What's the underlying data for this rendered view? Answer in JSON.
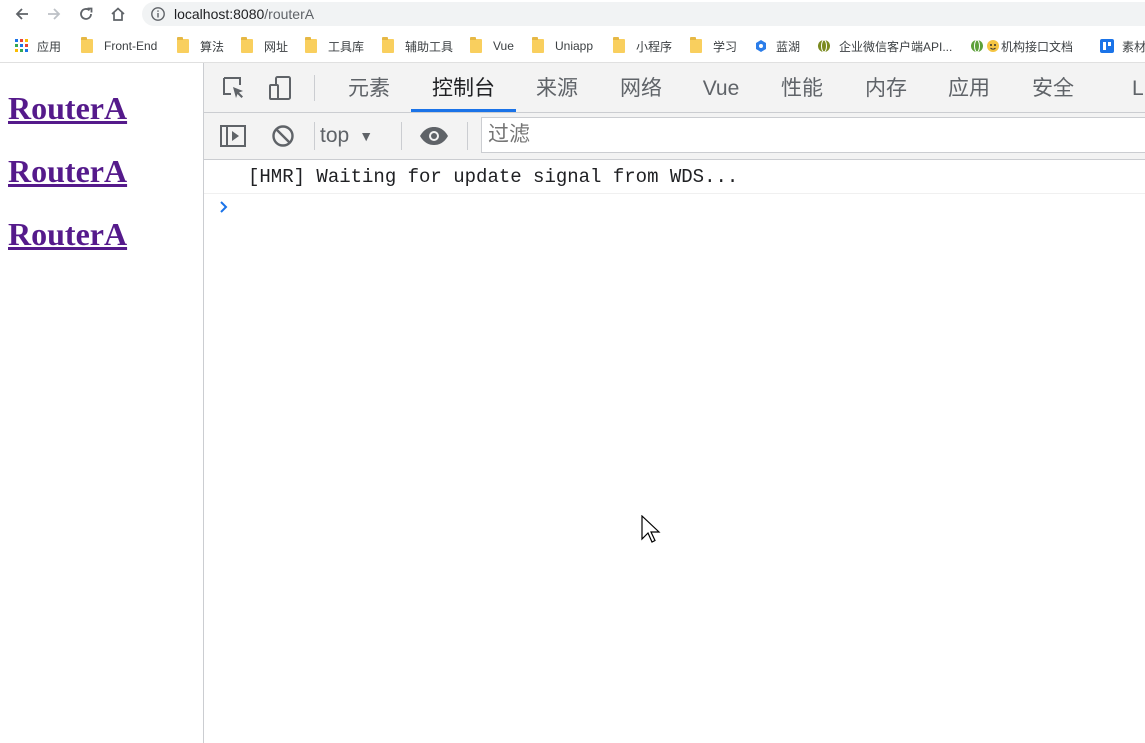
{
  "browser": {
    "url_host": "localhost:8080",
    "url_path": "/routerA",
    "bookmarks": [
      {
        "label": "应用",
        "icon": "apps-grid-icon"
      },
      {
        "label": "Front-End",
        "icon": "folder-icon"
      },
      {
        "label": "算法",
        "icon": "folder-icon"
      },
      {
        "label": "网址",
        "icon": "folder-icon"
      },
      {
        "label": "工具库",
        "icon": "folder-icon"
      },
      {
        "label": "辅助工具",
        "icon": "folder-icon"
      },
      {
        "label": "Vue",
        "icon": "folder-icon"
      },
      {
        "label": "Uniapp",
        "icon": "folder-icon"
      },
      {
        "label": "小程序",
        "icon": "folder-icon"
      },
      {
        "label": "学习",
        "icon": "folder-icon"
      },
      {
        "label": "蓝湖",
        "icon": "lanhu-icon"
      },
      {
        "label": "企业微信客户端API...",
        "icon": "globe-icon"
      },
      {
        "label": "机构接口文档",
        "icon": "globe-icon"
      },
      {
        "label": "素材",
        "icon": "app-icon"
      }
    ]
  },
  "page": {
    "links": [
      "RouterA",
      "RouterA",
      "RouterA"
    ]
  },
  "devtools": {
    "tabs": [
      "元素",
      "控制台",
      "来源",
      "网络",
      "Vue",
      "性能",
      "内存",
      "应用",
      "安全",
      "Li"
    ],
    "active_tab": "控制台",
    "context": "top",
    "filter_placeholder": "过滤",
    "messages": [
      "[HMR] Waiting for update signal from WDS..."
    ]
  },
  "colors": {
    "link_visited": "#551a8b",
    "active_tab_underline": "#1a73e8",
    "prompt_arrow": "#1a73e8"
  }
}
